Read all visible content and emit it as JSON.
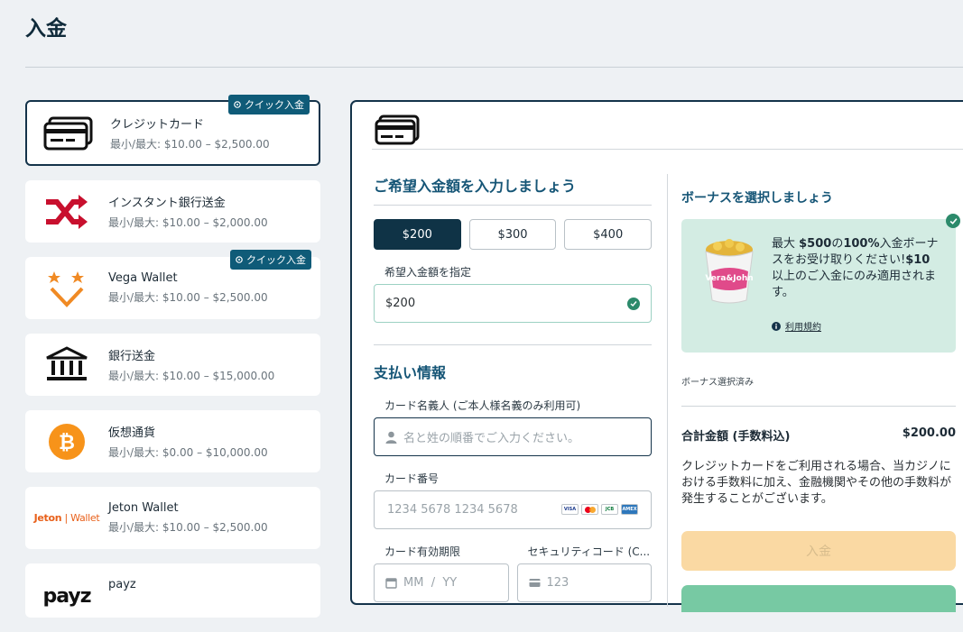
{
  "page": {
    "title": "入金"
  },
  "methods": [
    {
      "name": "クレジットカード",
      "limits": "最小/最大: $10.00 – $2,500.00",
      "badge": "クイック入金",
      "icon": "credit-card-icon"
    },
    {
      "name": "インスタント銀行送金",
      "limits": "最小/最大: $10.00 – $2,000.00",
      "icon": "shuffle-icon"
    },
    {
      "name": "Vega Wallet",
      "limits": "最小/最大: $10.00 – $2,500.00",
      "badge": "クイック入金",
      "icon": "vega-wallet-icon"
    },
    {
      "name": "銀行送金",
      "limits": "最小/最大: $10.00 – $15,000.00",
      "icon": "bank-icon"
    },
    {
      "name": "仮想通貨",
      "limits": "最小/最大: $0.00 – $10,000.00",
      "icon": "bitcoin-icon"
    },
    {
      "name": "Jeton Wallet",
      "limits": "最小/最大: $10.00 – $2,500.00",
      "logo_text": "Jeton",
      "logo_text2": "Wallet",
      "icon": "jeton-logo"
    },
    {
      "name": "payz",
      "logo_text": "payz",
      "icon": "payz-logo"
    }
  ],
  "amount": {
    "title": "ご希望入金額を入力しましょう",
    "options": [
      "$200",
      "$300",
      "$400"
    ],
    "custom_label": "希望入金額を指定",
    "custom_value": "$200"
  },
  "payment": {
    "title": "支払い情報",
    "name_label": "カード名義人 (ご本人様名義のみ利用可)",
    "name_placeholder": "名と姓の順番でご入力ください。",
    "number_label": "カード番号",
    "number_placeholder": "1234 5678 1234 5678",
    "expiry_label": "カード有効期限",
    "expiry_placeholder": "MM  /  YY",
    "cvc_label": "セキュリティコード (C...",
    "cvc_placeholder": "123",
    "card_brands": [
      "VISA",
      "MC",
      "JCB",
      "AMEX"
    ]
  },
  "bonus": {
    "title": "ボーナスを選択しましょう",
    "line1_pre": "最大 ",
    "line1_amount": "$500",
    "line1_mid": "の",
    "line1_pct": "100%",
    "line1_post": "入金ボーナスをお受け取りください!",
    "line2_amount": "$10",
    "line2_post": "以上のご入金にのみ適用されます。",
    "terms": "利用規約",
    "selected_note": "ボーナス選択済み",
    "bucket_label": "Vera&John"
  },
  "summary": {
    "total_label": "合計金額 (手数料込)",
    "total_value": "$200.00",
    "fee_note": "クレジットカードをご利用される場合、当カジノにおける手数料に加え、金融機関やその他の手数料が発生することがございます。",
    "deposit_button": "入金"
  },
  "colors": {
    "accent": "#0f3346",
    "title": "#155576",
    "bonus_bg": "#d3ece3",
    "deposit_btn": "#fad9a3",
    "badge": "#0f5b78"
  }
}
